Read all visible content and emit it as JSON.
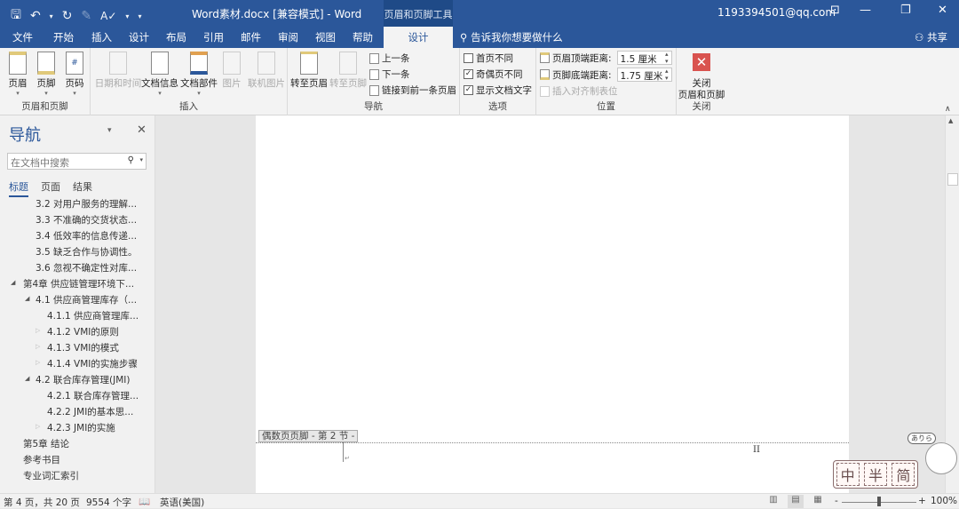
{
  "titlebar": {
    "document_title": "Word素材.docx [兼容模式]  -  Word",
    "context_tab_group": "页眉和页脚工具",
    "account": "1193394501@qq.com",
    "qat": {
      "save": "🖫",
      "undo": "↶",
      "undo_dd": "▾",
      "redo": "↻",
      "format_painter": "✎",
      "spelling": "A✓",
      "spelling_dd": "▾",
      "customize": "▾"
    },
    "window_controls": {
      "ribbon_options": "⊡",
      "minimize": "—",
      "restore": "❐",
      "close": "✕"
    }
  },
  "tabs": [
    "文件",
    "开始",
    "插入",
    "设计",
    "布局",
    "引用",
    "邮件",
    "审阅",
    "视图",
    "帮助",
    "设计"
  ],
  "active_tab_index": 10,
  "tell_me": "告诉我你想要做什么",
  "share": "共享",
  "ribbon": {
    "groups": {
      "header_footer": {
        "label": "页眉和页脚",
        "buttons": [
          "页眉",
          "页脚",
          "页码"
        ]
      },
      "insert": {
        "label": "插入",
        "buttons": [
          {
            "label": "日期和时间",
            "enabled": false
          },
          {
            "label": "文档信息",
            "enabled": true
          },
          {
            "label": "文档部件",
            "enabled": true
          },
          {
            "label": "图片",
            "enabled": false
          },
          {
            "label": "联机图片",
            "enabled": false
          }
        ]
      },
      "navigation": {
        "label": "导航",
        "go_to_header": "转至页眉",
        "go_to_footer": "转至页脚",
        "previous": "上一条",
        "next": "下一条",
        "link_to_previous": "链接到前一条页眉"
      },
      "options": {
        "label": "选项",
        "checkboxes": [
          {
            "label": "首页不同",
            "checked": false
          },
          {
            "label": "奇偶页不同",
            "checked": true
          },
          {
            "label": "显示文档文字",
            "checked": true
          }
        ]
      },
      "position": {
        "label": "位置",
        "header_from_top_label": "页眉顶端距离:",
        "header_from_top_value": "1.5 厘米",
        "footer_from_bottom_label": "页脚底端距离:",
        "footer_from_bottom_value": "1.75 厘米",
        "insert_alignment_tab": "插入对齐制表位"
      },
      "close": {
        "label": "关闭",
        "button_line1": "关闭",
        "button_line2": "页眉和页脚"
      }
    }
  },
  "nav_pane": {
    "title": "导航",
    "search_placeholder": "在文档中搜索",
    "tabs": [
      "标题",
      "页面",
      "结果"
    ],
    "active_tab": 0,
    "outline": [
      {
        "text": "3.2 对用户服务的理解...",
        "level": 2,
        "toggle": "none"
      },
      {
        "text": "3.3 不准确的交货状态...",
        "level": 2,
        "toggle": "none"
      },
      {
        "text": "3.4 低效率的信息传递...",
        "level": 2,
        "toggle": "none"
      },
      {
        "text": "3.5 缺乏合作与协调性。",
        "level": 2,
        "toggle": "none"
      },
      {
        "text": "3.6 忽视不确定性对库...",
        "level": 2,
        "toggle": "none"
      },
      {
        "text": "第4章 供应链管理环境下...",
        "level": 1,
        "toggle": "expanded"
      },
      {
        "text": "4.1 供应商管理库存（...",
        "level": 2,
        "toggle": "expanded"
      },
      {
        "text": "4.1.1 供应商管理库...",
        "level": 3,
        "toggle": "none"
      },
      {
        "text": "4.1.2 VMI的原则",
        "level": 3,
        "toggle": "collapsed"
      },
      {
        "text": "4.1.3 VMI的模式",
        "level": 3,
        "toggle": "collapsed"
      },
      {
        "text": "4.1.4 VMI的实施步骤",
        "level": 3,
        "toggle": "collapsed"
      },
      {
        "text": "4.2 联合库存管理(JMI)",
        "level": 2,
        "toggle": "expanded"
      },
      {
        "text": "4.2.1 联合库存管理...",
        "level": 3,
        "toggle": "none"
      },
      {
        "text": "4.2.2 JMI的基本思...",
        "level": 3,
        "toggle": "none"
      },
      {
        "text": "4.2.3 JMI的实施",
        "level": 3,
        "toggle": "collapsed"
      },
      {
        "text": "第5章 结论",
        "level": 1,
        "toggle": "none"
      },
      {
        "text": "参考书目",
        "level": 1,
        "toggle": "none"
      },
      {
        "text": "专业词汇索引",
        "level": 1,
        "toggle": "none"
      }
    ]
  },
  "document": {
    "footer_tag": "偶数页页脚 - 第 2 节 -",
    "page_number_text": "II",
    "paragraph_mark": "↵"
  },
  "statusbar": {
    "page_info": "第 4 页，共 20 页",
    "word_count": "9554 个字",
    "proofing_icon": "📖",
    "language": "英语(美国)",
    "zoom_minus": "-",
    "zoom_plus": "+",
    "zoom_level": "100%",
    "zoom_fraction": 0.5
  },
  "overlay": {
    "sticker_chars": [
      "中",
      "半",
      "简"
    ],
    "bubble": "ありら"
  },
  "colors": {
    "accent": "#2b579a",
    "close_button": "#d9534f"
  }
}
